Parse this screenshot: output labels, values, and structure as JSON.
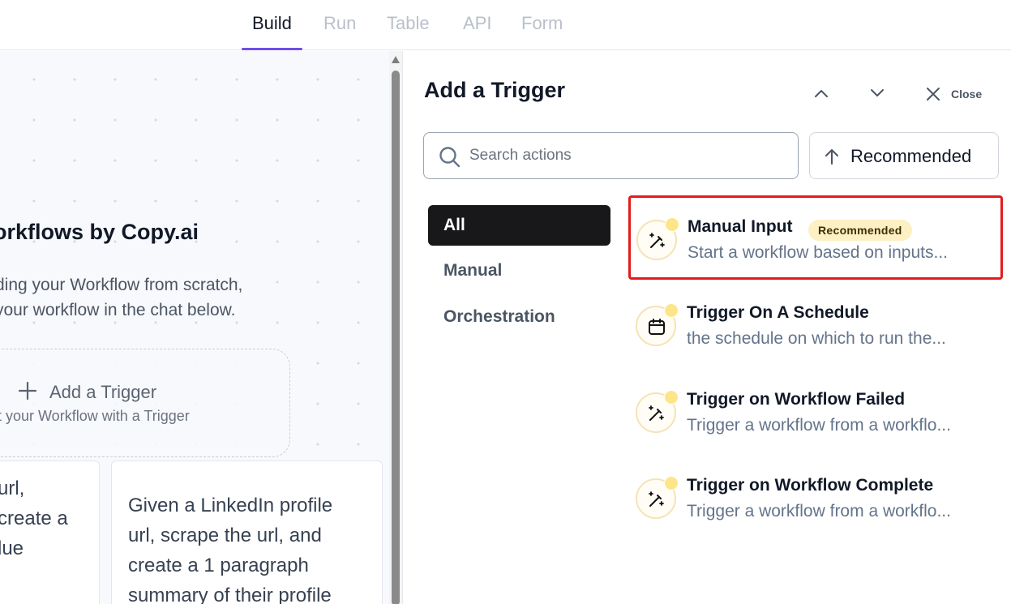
{
  "tabs": [
    {
      "label": "Build",
      "active": true
    },
    {
      "label": "Run",
      "active": false
    },
    {
      "label": "Table",
      "active": false
    },
    {
      "label": "API",
      "active": false
    },
    {
      "label": "Form",
      "active": false
    }
  ],
  "canvas": {
    "title": "orkflows by Copy.ai",
    "subtitle_line1": "ding your Workflow from scratch,",
    "subtitle_line2": "your workflow in the chat below.",
    "trigger_box": {
      "label": "Add a Trigger",
      "hint": "t your Workflow with a Trigger"
    },
    "cards": [
      {
        "lines": [
          "url,",
          "create a",
          "lue"
        ]
      },
      {
        "lines": [
          "Given a LinkedIn profile",
          "url, scrape the url, and",
          "create a 1 paragraph",
          "summary of their profile"
        ]
      }
    ]
  },
  "panel": {
    "title": "Add a Trigger",
    "close_label": "Close",
    "search_placeholder": "Search actions",
    "sort_label": "Recommended",
    "categories": [
      {
        "label": "All",
        "active": true
      },
      {
        "label": "Manual",
        "active": false
      },
      {
        "label": "Orchestration",
        "active": false
      }
    ],
    "actions": [
      {
        "name": "Manual Input",
        "badge": "Recommended",
        "description": "Start a workflow based on inputs...",
        "icon": "magic-wand-icon",
        "selected": true
      },
      {
        "name": "Trigger On A Schedule",
        "description": "the schedule on which to run the...",
        "icon": "calendar-icon",
        "selected": false
      },
      {
        "name": "Trigger on Workflow Failed",
        "description": "Trigger a workflow from a workflo...",
        "icon": "magic-wand-icon",
        "selected": false
      },
      {
        "name": "Trigger on Workflow Complete",
        "description": "Trigger a workflow from a workflo...",
        "icon": "magic-wand-icon",
        "selected": false
      }
    ]
  },
  "colors": {
    "tab_underline": "#6d4ee8",
    "selection_border": "#e51b1b",
    "badge_bg": "#fdf0c2",
    "active_category_bg": "#18181b"
  }
}
